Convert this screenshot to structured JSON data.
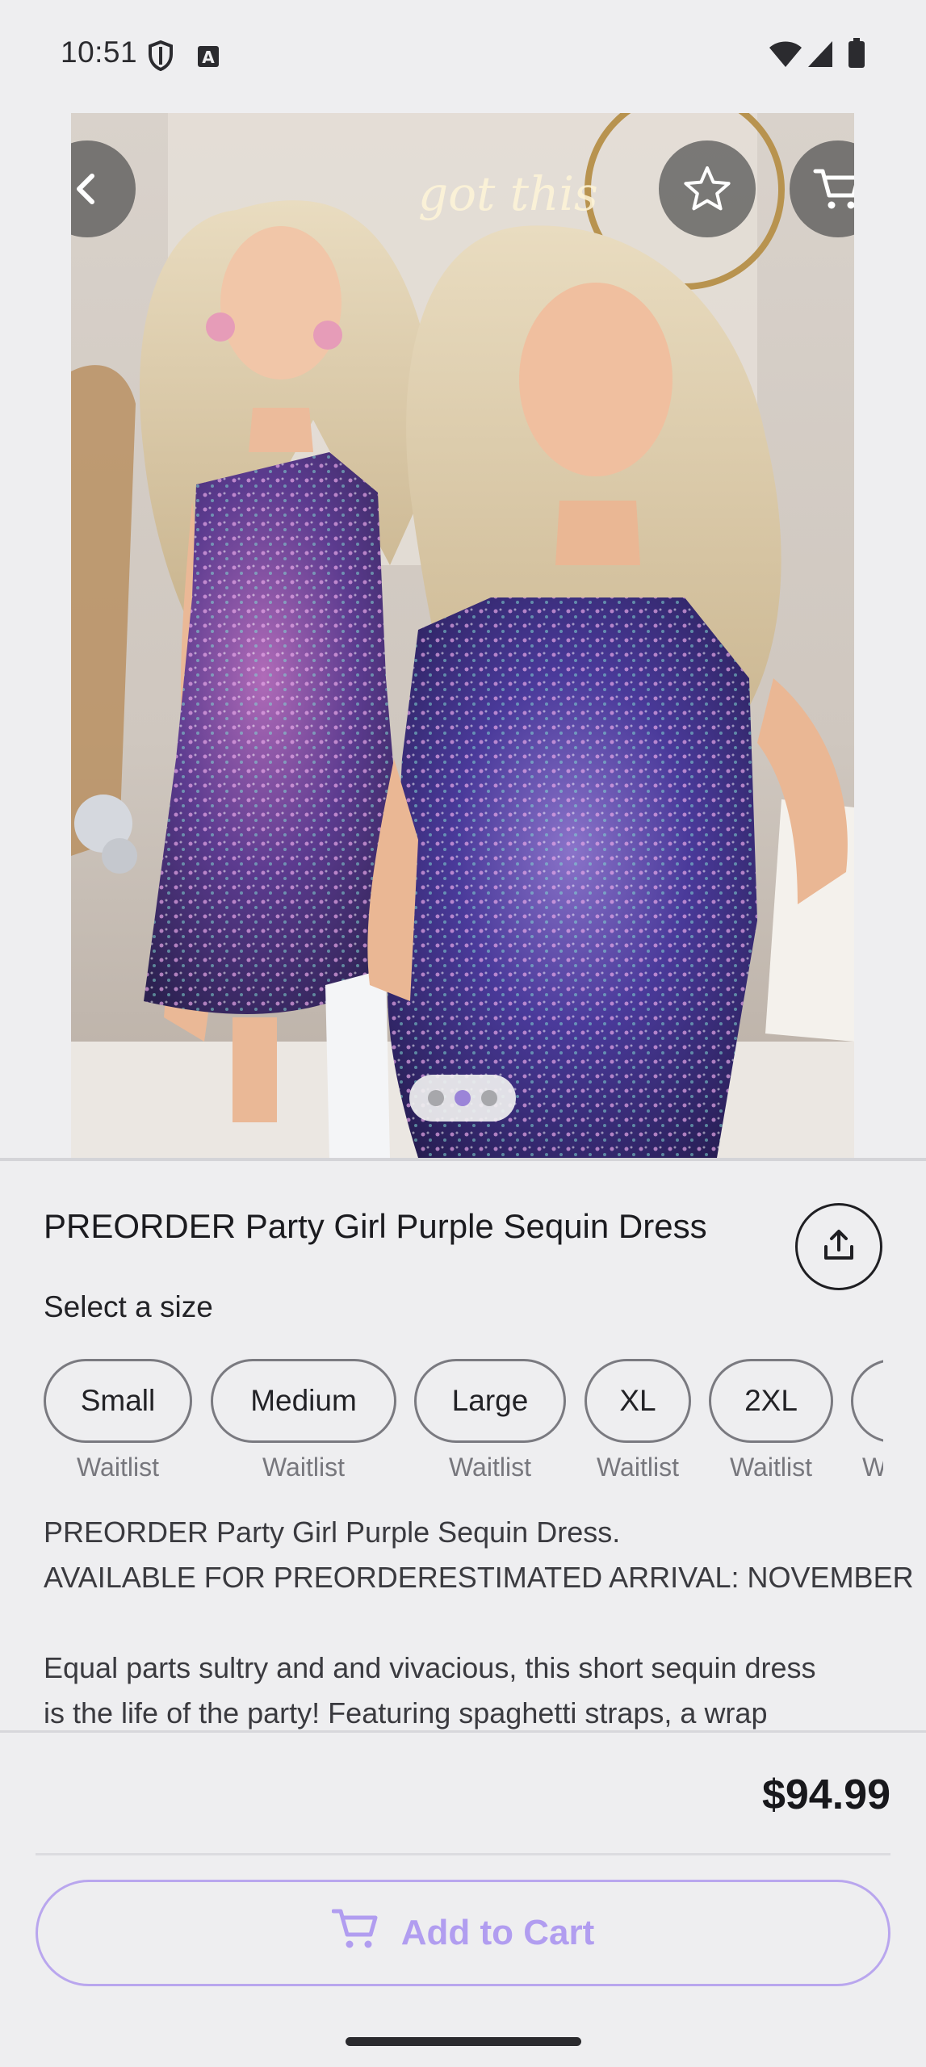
{
  "status": {
    "time": "10:51",
    "icons": [
      "shield-icon",
      "a-letter-icon",
      "wifi-icon",
      "signal-icon",
      "battery-icon"
    ]
  },
  "hero": {
    "buttons": [
      "back-arrow-icon",
      "star-icon",
      "cart-icon"
    ],
    "pager": {
      "count": 3,
      "active_index": 1
    },
    "photo_sign_text": "got this"
  },
  "product": {
    "title": "PREORDER Party Girl Purple Sequin Dress",
    "select_size_label": "Select a size",
    "sizes": [
      {
        "label": "Small",
        "status": "Waitlist"
      },
      {
        "label": "Medium",
        "status": "Waitlist"
      },
      {
        "label": "Large",
        "status": "Waitlist"
      },
      {
        "label": "XL",
        "status": "Waitlist"
      },
      {
        "label": "2XL",
        "status": "Waitlist"
      },
      {
        "label": "",
        "status": "W"
      }
    ],
    "description": {
      "line1": "PREORDER Party Girl Purple Sequin Dress.",
      "line2": "AVAILABLE FOR PREORDERESTIMATED ARRIVAL: NOVEMBER",
      "line3": "Equal parts sultry and and vivacious, this short sequin dress",
      "line4": "is the life of the party! Featuring spaghetti straps, a wrap"
    }
  },
  "footer": {
    "price": "$94.99",
    "add_to_cart_label": "Add to Cart"
  },
  "colors": {
    "accent": "#b19df0",
    "background": "#eeeef0",
    "pager_active": "#9b84d8"
  }
}
